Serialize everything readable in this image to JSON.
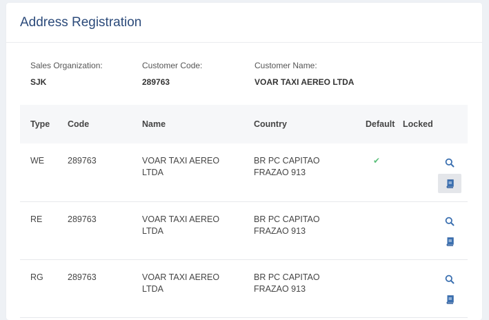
{
  "page": {
    "title": "Address Registration"
  },
  "info": {
    "sales_org_label": "Sales Organization:",
    "sales_org_value": "SJK",
    "customer_code_label": "Customer Code:",
    "customer_code_value": "289763",
    "customer_name_label": "Customer Name:",
    "customer_name_value": "VOAR TAXI AEREO LTDA"
  },
  "table": {
    "headers": {
      "type": "Type",
      "code": "Code",
      "name": "Name",
      "country": "Country",
      "default": "Default",
      "locked": "Locked"
    },
    "rows": [
      {
        "type": "WE",
        "code": "289763",
        "name_line1": "VOAR TAXI AEREO",
        "name_line2": "LTDA",
        "country_line1": "BR PC CAPITAO",
        "country_line2": "FRAZAO 913",
        "default": "✔"
      },
      {
        "type": "RE",
        "code": "289763",
        "name_line1": "VOAR TAXI AEREO",
        "name_line2": "LTDA",
        "country_line1": "BR PC CAPITAO",
        "country_line2": "FRAZAO 913",
        "default": ""
      },
      {
        "type": "RG",
        "code": "289763",
        "name_line1": "VOAR TAXI AEREO",
        "name_line2": "LTDA",
        "country_line1": "BR PC CAPITAO",
        "country_line2": "FRAZAO 913",
        "default": ""
      }
    ]
  },
  "colors": {
    "title": "#2b4a7a",
    "accent": "#3a6fb0",
    "check": "#5bbf7a"
  },
  "icons": {
    "search": "search-icon",
    "book": "book-icon",
    "check": "check-icon"
  }
}
